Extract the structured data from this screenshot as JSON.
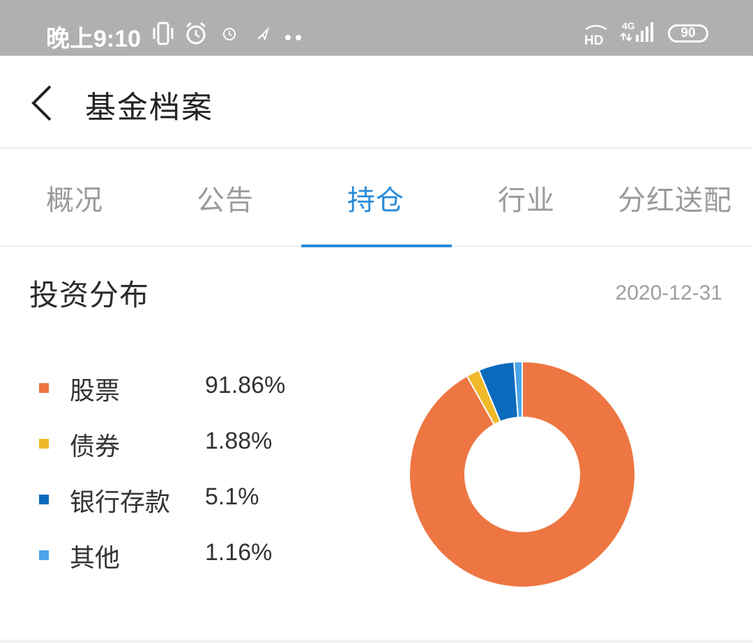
{
  "status_bar": {
    "time": "晚上9:10",
    "icons": [
      "vibrate-icon",
      "alarm-icon",
      "clock-icon",
      "location-icon",
      "more-dots-icon",
      "hd-icon",
      "signal-icon"
    ],
    "hd_label": "HD",
    "network_label": "4G",
    "battery": "90"
  },
  "header": {
    "title": "基金档案",
    "back_icon": "chevron-left-icon"
  },
  "tabs": [
    {
      "label": "概况",
      "active": false
    },
    {
      "label": "公告",
      "active": false
    },
    {
      "label": "持仓",
      "active": true
    },
    {
      "label": "行业",
      "active": false
    },
    {
      "label": "分红送配",
      "active": false
    }
  ],
  "section": {
    "title": "投资分布",
    "date": "2020-12-31"
  },
  "legend": [
    {
      "label": "股票",
      "value": "91.86%",
      "color": "#ee7642"
    },
    {
      "label": "债券",
      "value": "1.88%",
      "color": "#f0b92a"
    },
    {
      "label": "银行存款",
      "value": "5.1%",
      "color": "#0a6bbd"
    },
    {
      "label": "其他",
      "value": "1.16%",
      "color": "#4aa4ea"
    }
  ],
  "chart_data": {
    "type": "pie",
    "donut": true,
    "categories": [
      "股票",
      "债券",
      "银行存款",
      "其他"
    ],
    "values": [
      91.86,
      1.88,
      5.1,
      1.16
    ],
    "colors": [
      "#ee7642",
      "#f0b92a",
      "#0a6bbd",
      "#4aa4ea"
    ],
    "start": "top",
    "direction": "clockwise"
  }
}
